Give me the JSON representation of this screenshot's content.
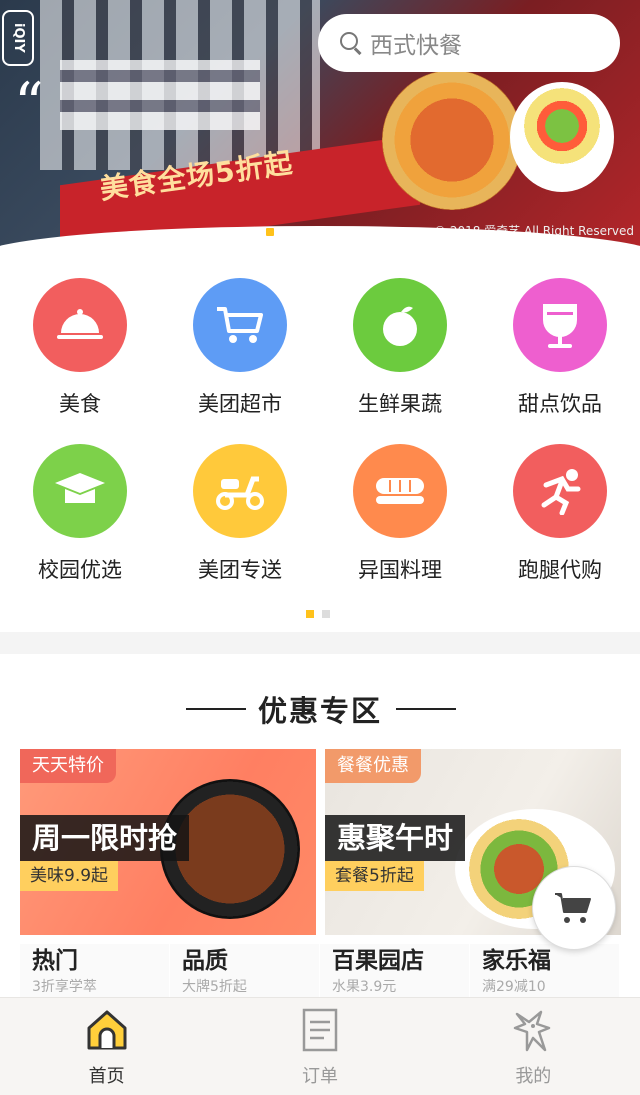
{
  "banner": {
    "app_badge": "iQIY",
    "promo_text": "美食全场5折起",
    "copyright": "© 2018 爱奇艺 All Right Reserved",
    "dots": 6,
    "active_dot": 0
  },
  "search": {
    "placeholder": "西式快餐"
  },
  "categories": [
    {
      "label": "美食",
      "icon": "food-cloche-icon",
      "color": "#f25e5e"
    },
    {
      "label": "美团超市",
      "icon": "shopping-cart-icon",
      "color": "#5e9cf5"
    },
    {
      "label": "生鲜果蔬",
      "icon": "apple-icon",
      "color": "#6ccb3e"
    },
    {
      "label": "甜点饮品",
      "icon": "drink-glass-icon",
      "color": "#ee5fcf"
    },
    {
      "label": "校园优选",
      "icon": "graduation-cap-icon",
      "color": "#7dd14a"
    },
    {
      "label": "美团专送",
      "icon": "scooter-icon",
      "color": "#ffc93b"
    },
    {
      "label": "异国料理",
      "icon": "sushi-icon",
      "color": "#ff8a4d"
    },
    {
      "label": "跑腿代购",
      "icon": "runner-icon",
      "color": "#f25e5e"
    }
  ],
  "deals": {
    "title": "优惠专区",
    "cards": [
      {
        "tag": "天天特价",
        "headline": "周一限时抢",
        "sub": "美味9.9起"
      },
      {
        "tag": "餐餐优惠",
        "headline": "惠聚午时",
        "sub": "套餐5折起"
      }
    ],
    "shops": [
      {
        "name": "热门",
        "desc": "3折享学萃"
      },
      {
        "name": "品质",
        "desc": "大牌5折起"
      },
      {
        "name": "百果园店",
        "desc": "水果3.9元"
      },
      {
        "name": "家乐福",
        "desc": "满29减10"
      }
    ]
  },
  "tabbar": [
    {
      "label": "首页",
      "icon": "home-icon",
      "active": true
    },
    {
      "label": "订单",
      "icon": "order-list-icon",
      "active": false
    },
    {
      "label": "我的",
      "icon": "kangaroo-profile-icon",
      "active": false
    }
  ],
  "colors": {
    "accent": "#ffc21b",
    "deal_tag": "#f0675a",
    "sub_tag": "#ffcf5e"
  }
}
